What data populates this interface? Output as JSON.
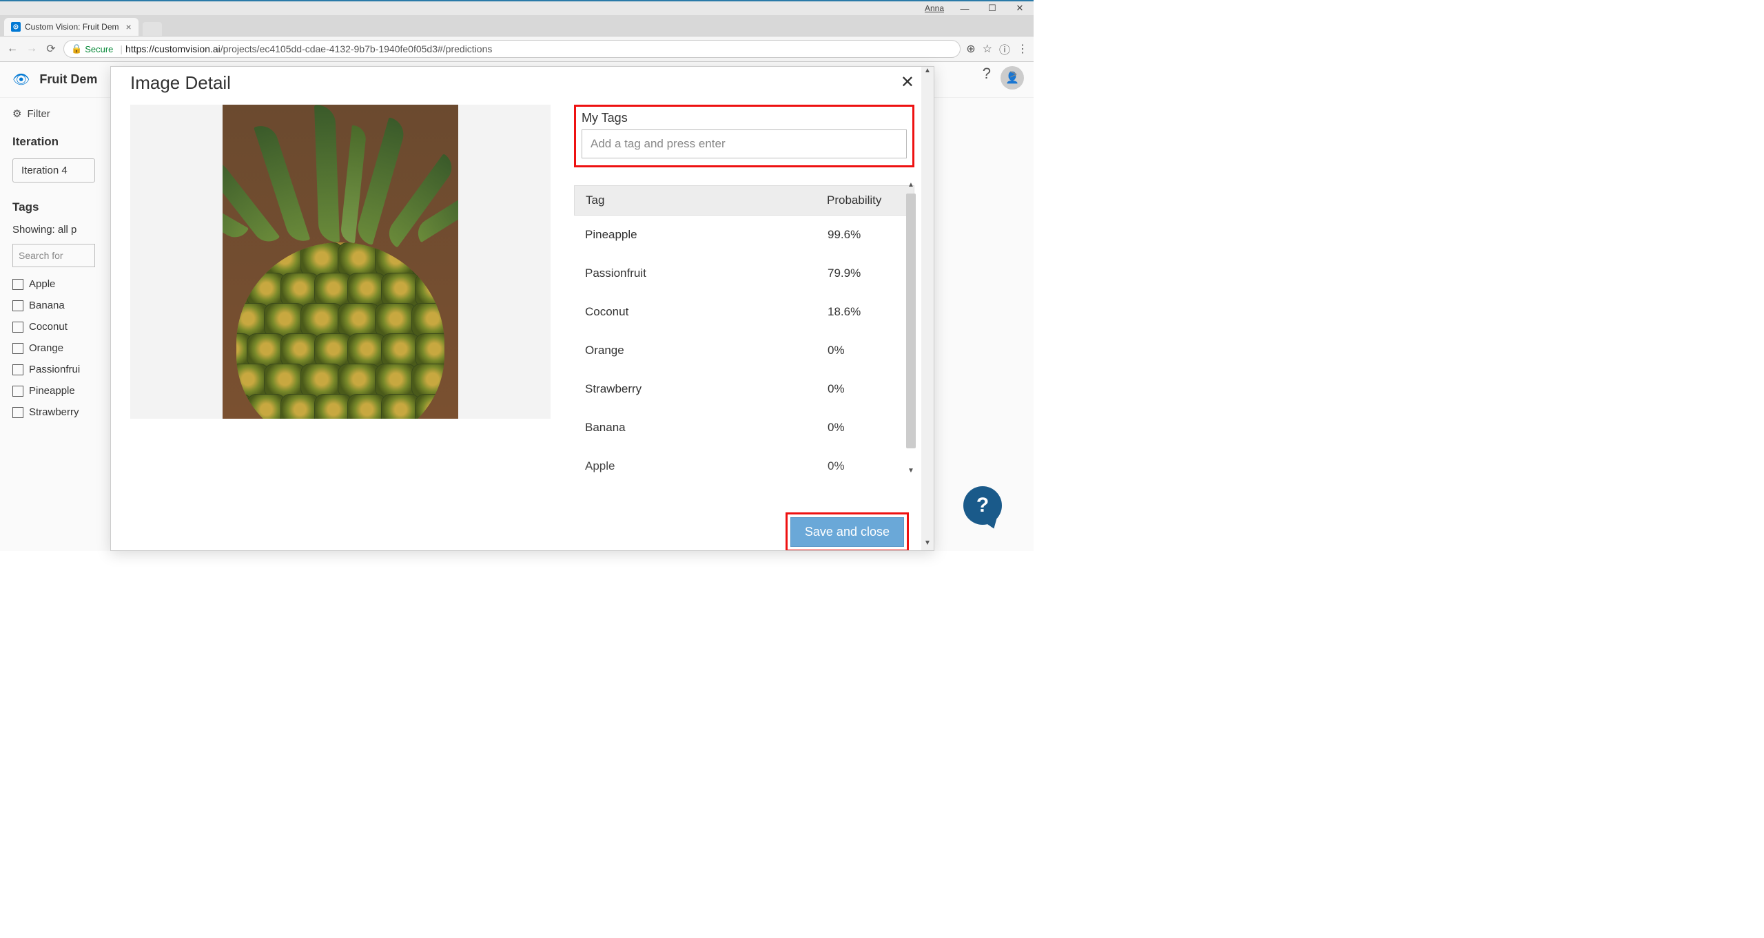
{
  "window": {
    "user": "Anna",
    "tab_title": "Custom Vision: Fruit Dem",
    "secure_label": "Secure",
    "url_host": "https://customvision.ai",
    "url_path": "/projects/ec4105dd-cdae-4132-9b7b-1940fe0f05d3#/predictions"
  },
  "app": {
    "project_name": "Fruit Dem",
    "filter_label": "Filter",
    "iteration_label": "Iteration",
    "iteration_value": "Iteration 4",
    "tags_label": "Tags",
    "showing_text": "Showing: all p",
    "search_placeholder": "Search for",
    "tag_list": [
      "Apple",
      "Banana",
      "Coconut",
      "Orange",
      "Passionfrui",
      "Pineapple",
      "Strawberry"
    ]
  },
  "modal": {
    "title": "Image Detail",
    "mytags_label": "My Tags",
    "tag_input_placeholder": "Add a tag and press enter",
    "col_tag": "Tag",
    "col_prob": "Probability",
    "predictions": [
      {
        "tag": "Pineapple",
        "prob": "99.6%"
      },
      {
        "tag": "Passionfruit",
        "prob": "79.9%"
      },
      {
        "tag": "Coconut",
        "prob": "18.6%"
      },
      {
        "tag": "Orange",
        "prob": "0%"
      },
      {
        "tag": "Strawberry",
        "prob": "0%"
      },
      {
        "tag": "Banana",
        "prob": "0%"
      },
      {
        "tag": "Apple",
        "prob": "0%"
      }
    ],
    "save_label": "Save and close"
  },
  "help": {
    "symbol": "?"
  }
}
